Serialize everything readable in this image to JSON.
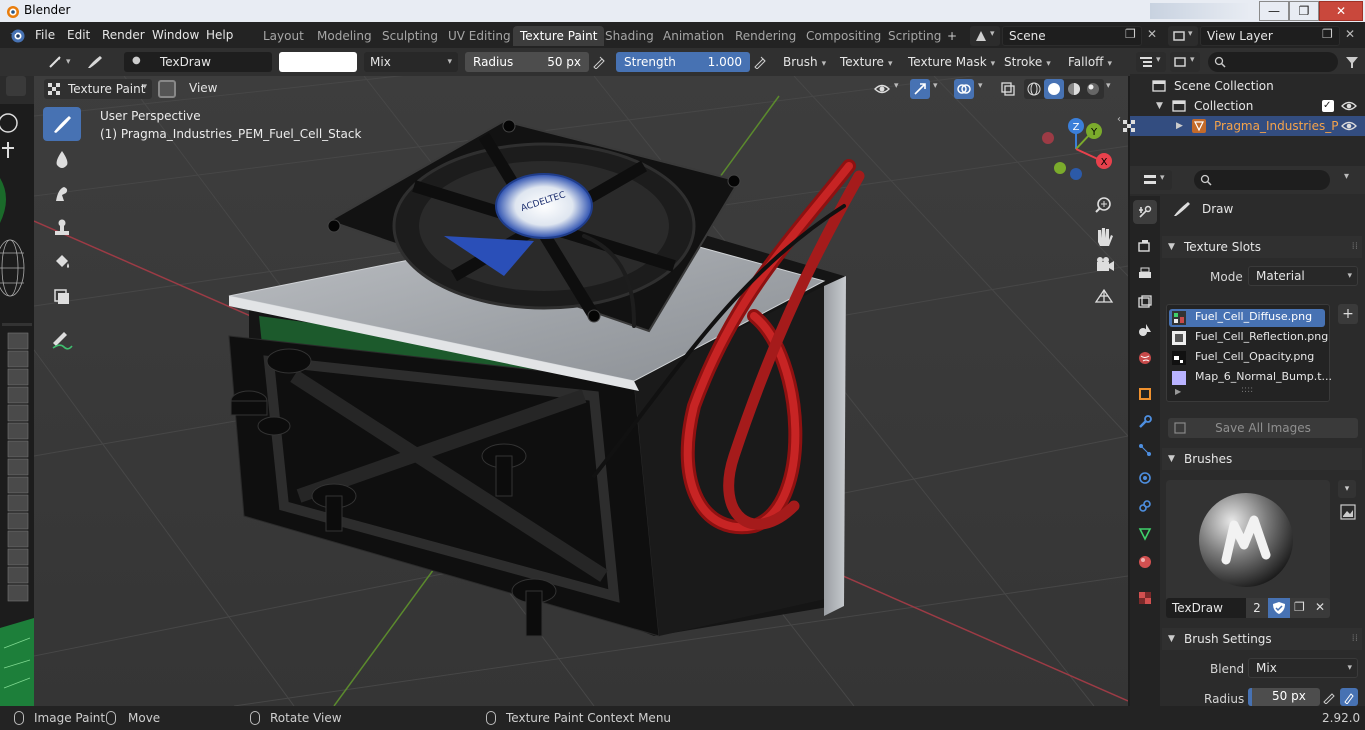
{
  "window": {
    "title": "Blender",
    "minimize": "—",
    "maximize": "❐",
    "close": "✕"
  },
  "menus": [
    "File",
    "Edit",
    "Render",
    "Window",
    "Help"
  ],
  "workspaces": [
    "Layout",
    "Modeling",
    "Sculpting",
    "UV Editing",
    "Texture Paint",
    "Shading",
    "Animation",
    "Rendering",
    "Compositing",
    "Scripting"
  ],
  "add_workspace": "+",
  "scene": {
    "name": "Scene"
  },
  "view_layer": {
    "name": "View Layer"
  },
  "toolhdr": {
    "brush_name": "TexDraw",
    "blend": "Mix",
    "radius_label": "Radius",
    "radius_value": "50 px",
    "strength_label": "Strength",
    "strength_value": "1.000",
    "brush_menu": "Brush",
    "texture_menu": "Texture",
    "texture_mask_menu": "Texture Mask",
    "stroke_menu": "Stroke",
    "falloff_menu": "Falloff"
  },
  "viewport": {
    "mode": "Texture Paint",
    "view_menu": "View",
    "perspective": "User Perspective",
    "object_info": "(1) Pragma_Industries_PEM_Fuel_Cell_Stack",
    "fan_label": "ACDELTEC",
    "gizmo": {
      "x": "X",
      "y": "Y",
      "z": "Z",
      "colors": {
        "x": "#e8414c",
        "y": "#7bab2c",
        "z": "#3b7fd9"
      }
    }
  },
  "outliner": {
    "scene_collection": "Scene Collection",
    "collection": "Collection",
    "object": "Pragma_Industries_P"
  },
  "properties": {
    "tool_name": "Draw",
    "texture_slots": {
      "header": "Texture Slots",
      "mode_label": "Mode",
      "mode_value": "Material",
      "slots": [
        "Fuel_Cell_Diffuse.png",
        "Fuel_Cell_Reflection.png",
        "Fuel_Cell_Opacity.png",
        "Map_6_Normal_Bump.t..."
      ],
      "save_all": "Save All Images",
      "add": "+"
    },
    "brushes": {
      "header": "Brushes",
      "brush_name": "TexDraw",
      "users": "2"
    },
    "brush_settings": {
      "header": "Brush Settings",
      "blend_label": "Blend",
      "blend_value": "Mix",
      "radius_label": "Radius",
      "radius_value": "50 px"
    }
  },
  "statusbar": {
    "image_paint": "Image Paint",
    "move": "Move",
    "rotate_view": "Rotate View",
    "context_menu": "Texture Paint Context Menu",
    "version": "2.92.0"
  },
  "colors": {
    "accent": "#4772b3",
    "active_object": "#f5a34a"
  }
}
